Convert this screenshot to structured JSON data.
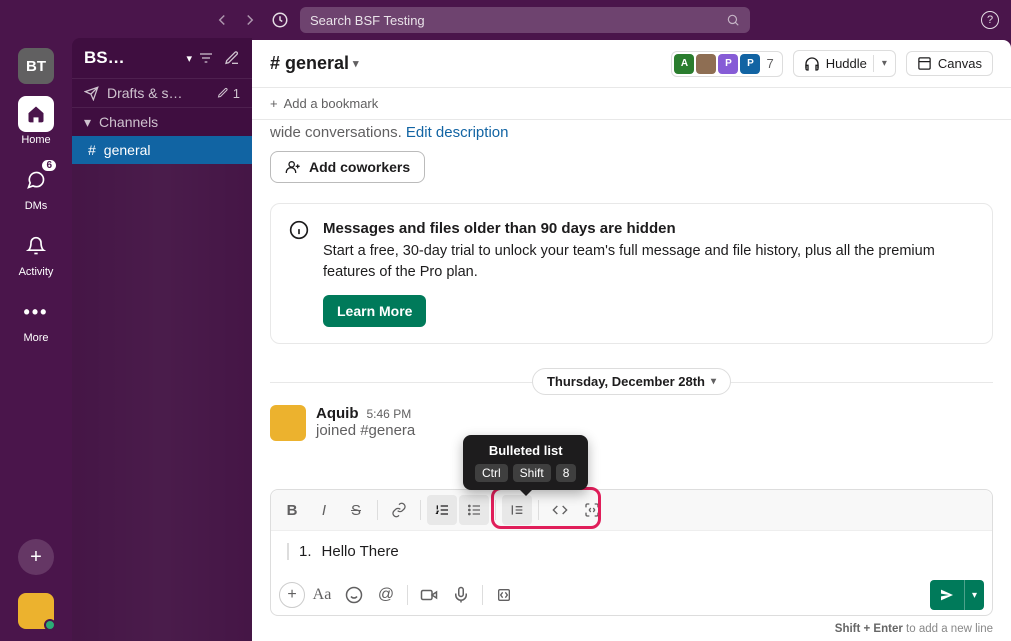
{
  "titlebar": {
    "search_placeholder": "Search BSF Testing"
  },
  "rail": {
    "workspace_initials": "BT",
    "items": [
      {
        "label": "Home",
        "active": true
      },
      {
        "label": "DMs",
        "badge": "6"
      },
      {
        "label": "Activity"
      },
      {
        "label": "More"
      }
    ]
  },
  "sidebar": {
    "workspace_name": "BS…",
    "drafts_label": "Drafts & s…",
    "drafts_count": "1",
    "channels_section": "Channels",
    "channels": [
      {
        "name": "general",
        "active": true
      }
    ]
  },
  "channel": {
    "name": "# general",
    "member_count": "7",
    "huddle_label": "Huddle",
    "canvas_label": "Canvas",
    "bookmark_label": "Add a bookmark",
    "description_prefix": "wide conversations. ",
    "edit_description": "Edit description",
    "add_coworkers": "Add coworkers"
  },
  "banner": {
    "title": "Messages and files older than 90 days are hidden",
    "text": "Start a free, 30-day trial to unlock your team's full message and file history, plus all the premium features of the Pro plan.",
    "cta": "Learn More"
  },
  "date_divider": "Thursday, December 28th",
  "message": {
    "author": "Aquib",
    "time": "5:46 PM",
    "body": "joined #genera"
  },
  "tooltip": {
    "title": "Bulleted list",
    "keys": [
      "Ctrl",
      "Shift",
      "8"
    ]
  },
  "composer": {
    "ordered_number": "1.",
    "text": "Hello There"
  },
  "hint": {
    "keys": "Shift + Enter",
    "rest": " to add a new line"
  }
}
